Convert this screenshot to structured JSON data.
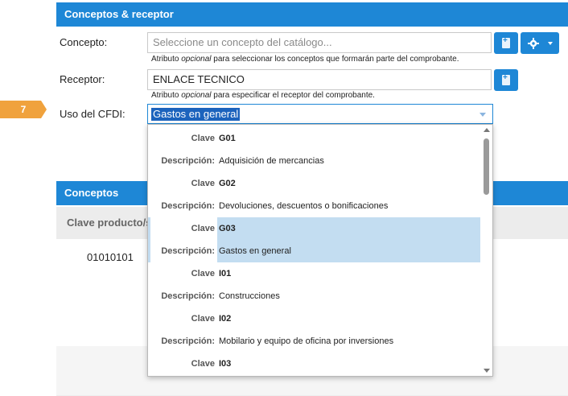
{
  "section_header": "Conceptos & receptor",
  "concepto": {
    "label": "Concepto:",
    "placeholder": "Seleccione un concepto del catálogo...",
    "hint_prefix": "Atributo ",
    "hint_em": "opcional",
    "hint_suffix": " para seleccionar los conceptos que formarán parte del comprobante."
  },
  "receptor": {
    "label": "Receptor:",
    "value": "ENLACE TECNICO",
    "hint_prefix": "Atributo ",
    "hint_em": "opcional",
    "hint_suffix": " para especificar el receptor del comprobante."
  },
  "step_badge": "7",
  "uso_cfdi": {
    "label": "Uso del CFDI:",
    "selected": "Gastos en general"
  },
  "conceptos_header": "Conceptos",
  "table": {
    "column_header": "Clave producto/s",
    "cell_value": "01010101"
  },
  "dropdown": {
    "clave_label": "Clave",
    "descripcion_label": "Descripción:",
    "options": [
      {
        "clave": "G01",
        "descripcion": "Adquisición de mercancias"
      },
      {
        "clave": "G02",
        "descripcion": "Devoluciones, descuentos o bonificaciones"
      },
      {
        "clave": "G03",
        "descripcion": "Gastos en general"
      },
      {
        "clave": "I01",
        "descripcion": "Construcciones"
      },
      {
        "clave": "I02",
        "descripcion": "Mobilario y equipo de oficina por inversiones"
      },
      {
        "clave": "I03",
        "descripcion": ""
      }
    ],
    "highlighted_index": 2
  },
  "colors": {
    "header_blue": "#1e87d6",
    "badge_orange": "#f0a23d",
    "highlight_blue": "#c3ddf1"
  },
  "icons": [
    "add-document-icon",
    "gear-icon",
    "caret-down-icon",
    "scroll-up-icon",
    "scroll-down-icon"
  ]
}
